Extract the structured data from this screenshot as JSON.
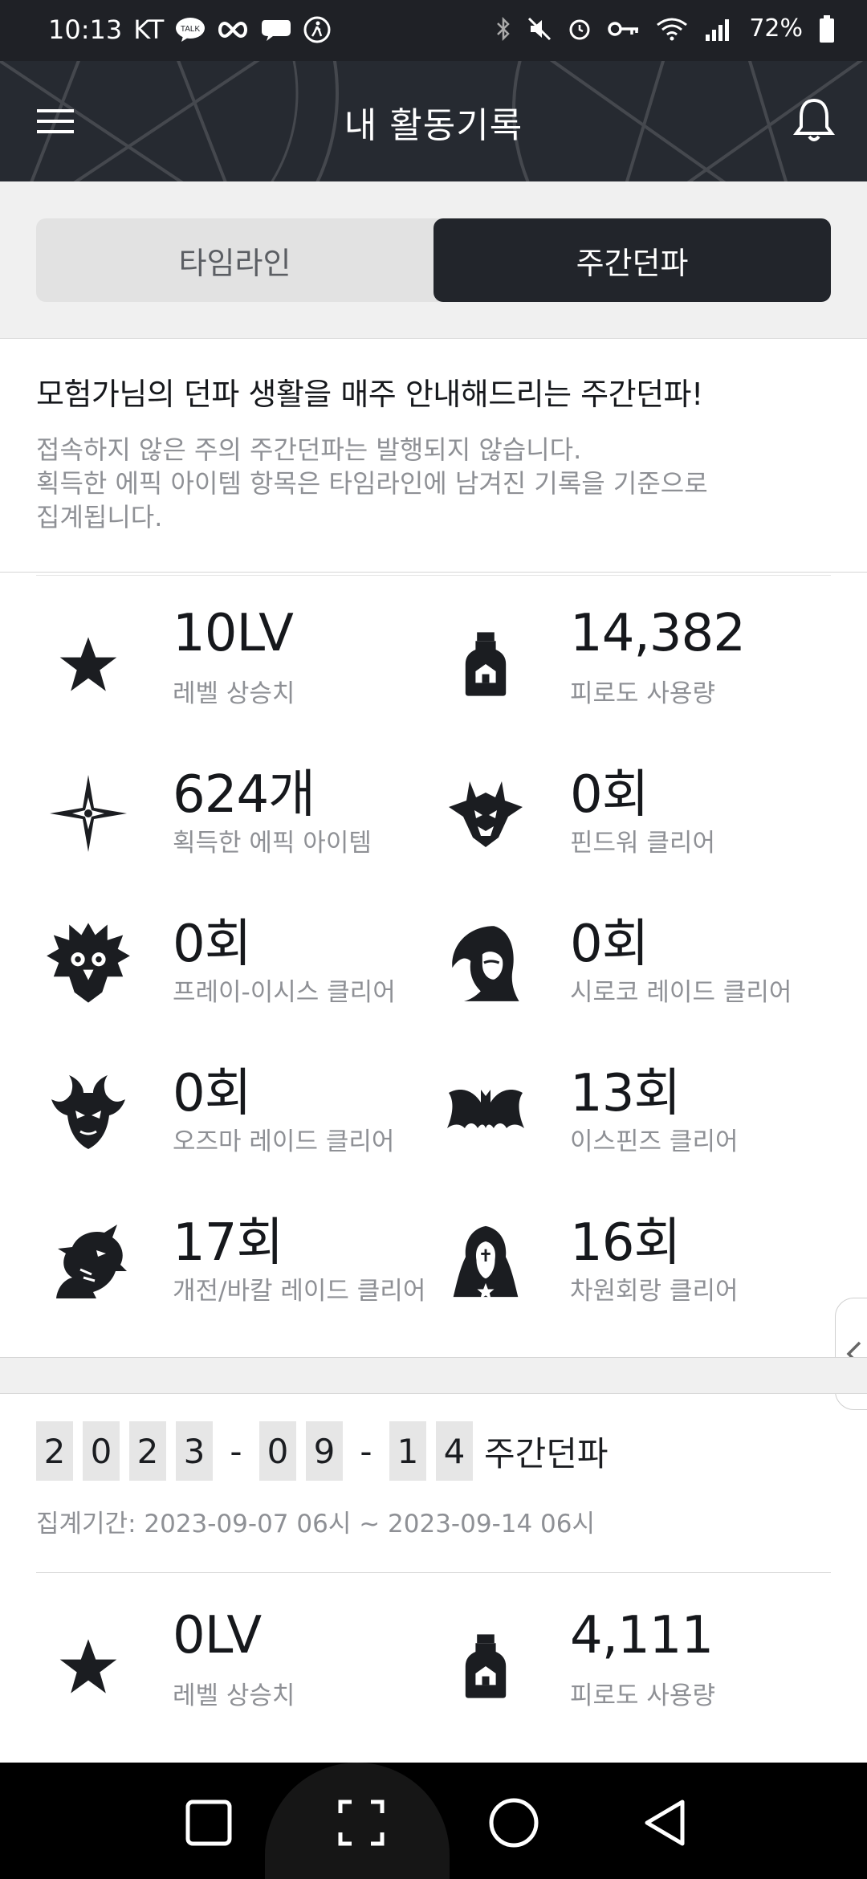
{
  "status_bar": {
    "time": "10:13",
    "carrier": "KT",
    "talk_badge": "TALK",
    "battery": "72%"
  },
  "header": {
    "title": "내 활동기록"
  },
  "tabs": [
    {
      "label": "타임라인",
      "active": false
    },
    {
      "label": "주간던파",
      "active": true
    }
  ],
  "intro": {
    "headline": "모험가님의 던파 생활을 매주 안내해드리는 주간던파!",
    "notes": [
      "접속하지 않은 주의 주간던파는 발행되지 않습니다.",
      "획득한 에픽 아이템 항목은 타임라인에 남겨진 기록을 기준으로",
      "집계됩니다."
    ]
  },
  "summary_stats": [
    {
      "icon": "star-icon",
      "value": "10LV",
      "label": "레벨 상승치"
    },
    {
      "icon": "potion-bottle-icon",
      "value": "14,382",
      "label": "피로도 사용량"
    },
    {
      "icon": "sparkle-star-icon",
      "value": "624개",
      "label": "획득한 에픽 아이템"
    },
    {
      "icon": "horned-demon-icon",
      "value": "0회",
      "label": "핀드워 클리어"
    },
    {
      "icon": "owl-monster-icon",
      "value": "0회",
      "label": "프레이-이시스 클리어"
    },
    {
      "icon": "hooded-woman-icon",
      "value": "0회",
      "label": "시로코 레이드 클리어"
    },
    {
      "icon": "horned-mask-icon",
      "value": "0회",
      "label": "오즈마 레이드 클리어"
    },
    {
      "icon": "bat-wings-icon",
      "value": "13회",
      "label": "이스핀즈 클리어"
    },
    {
      "icon": "dragon-head-icon",
      "value": "17회",
      "label": "개전/바칼 레이드 클리어"
    },
    {
      "icon": "hooded-figure-icon",
      "value": "16회",
      "label": "차원회랑 클리어"
    }
  ],
  "weekly": {
    "date_digits": [
      "2",
      "0",
      "2",
      "3",
      "-",
      "0",
      "9",
      "-",
      "1",
      "4"
    ],
    "suffix": "주간던파",
    "period": "집계기간: 2023-09-07 06시 ~ 2023-09-14 06시",
    "stats": [
      {
        "icon": "star-icon",
        "value": "0LV",
        "label": "레벨 상승치"
      },
      {
        "icon": "potion-bottle-icon",
        "value": "4,111",
        "label": "피로도 사용량"
      }
    ]
  },
  "colors": {
    "dark": "#22252b",
    "muted_text": "#8e9095",
    "tab_bg": "#e2e2e2"
  }
}
